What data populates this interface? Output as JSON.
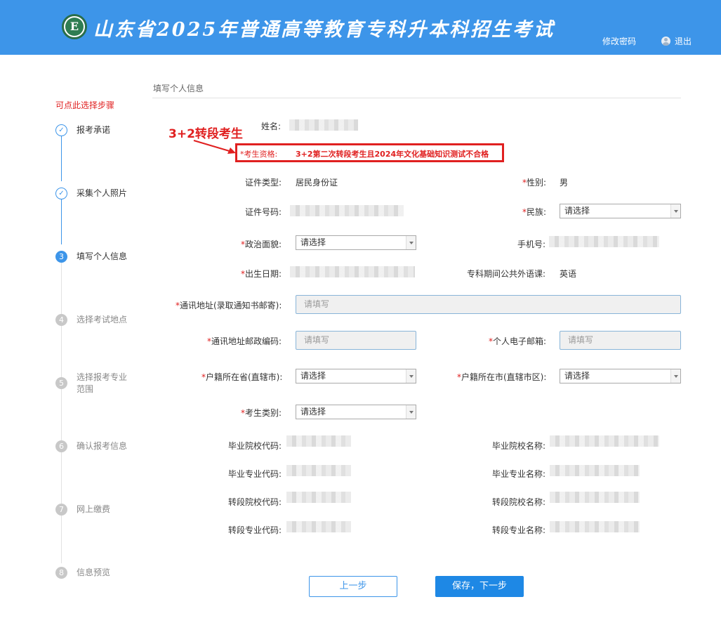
{
  "header": {
    "title": "山东省2025年普通高等教育专科升本科招生考试",
    "logo_letter": "E",
    "change_password": "修改密码",
    "logout": "退出"
  },
  "steps": {
    "hint": "可点此选择步骤",
    "items": [
      {
        "marker": "✓",
        "label": "报考承诺",
        "state": "done"
      },
      {
        "marker": "✓",
        "label": "采集个人照片",
        "state": "done"
      },
      {
        "marker": "3",
        "label": "填写个人信息",
        "state": "active"
      },
      {
        "marker": "4",
        "label": "选择考试地点",
        "state": "todo"
      },
      {
        "marker": "5",
        "label": "选择报考专业范围",
        "state": "todo"
      },
      {
        "marker": "6",
        "label": "确认报考信息",
        "state": "todo"
      },
      {
        "marker": "7",
        "label": "网上缴费",
        "state": "todo"
      },
      {
        "marker": "8",
        "label": "信息预览",
        "state": "todo"
      }
    ]
  },
  "form": {
    "section_title": "填写个人信息",
    "annotation": "3+2转段考生",
    "name_label": "姓名:",
    "qualification": {
      "label": "考生资格:",
      "value": "3+2第二次转段考生且2024年文化基础知识测试不合格"
    },
    "id_type": {
      "label": "证件类型:",
      "value": "居民身份证"
    },
    "gender": {
      "label": "性别:",
      "value": "男"
    },
    "id_number_label": "证件号码:",
    "ethnicity": {
      "label": "民族:",
      "value": "请选择"
    },
    "political": {
      "label": "政治面貌:",
      "value": "请选择"
    },
    "phone_label": "手机号:",
    "birth_label": "出生日期:",
    "language": {
      "label": "专科期间公共外语课:",
      "value": "英语"
    },
    "address": {
      "label": "通讯地址(录取通知书邮寄):",
      "placeholder": "请填写"
    },
    "postcode": {
      "label": "通讯地址邮政编码:",
      "placeholder": "请填写"
    },
    "email": {
      "label": "个人电子邮箱:",
      "placeholder": "请填写"
    },
    "province": {
      "label": "户籍所在省(直辖市):",
      "value": "请选择"
    },
    "city": {
      "label": "户籍所在市(直辖市区):",
      "value": "请选择"
    },
    "category": {
      "label": "考生类别:",
      "value": "请选择"
    },
    "grad_school_code_label": "毕业院校代码:",
    "grad_school_name_label": "毕业院校名称:",
    "grad_major_code_label": "毕业专业代码:",
    "grad_major_name_label": "毕业专业名称:",
    "transfer_school_code_label": "转段院校代码:",
    "transfer_school_name_label": "转段院校名称:",
    "transfer_major_code_label": "转段专业代码:",
    "transfer_major_name_label": "转段专业名称:",
    "required_mark": "*"
  },
  "buttons": {
    "prev": "上一步",
    "next": "保存，下一步"
  },
  "colors": {
    "header_bg": "#3d95e9",
    "required": "#e02020",
    "primary": "#1e88e5"
  }
}
